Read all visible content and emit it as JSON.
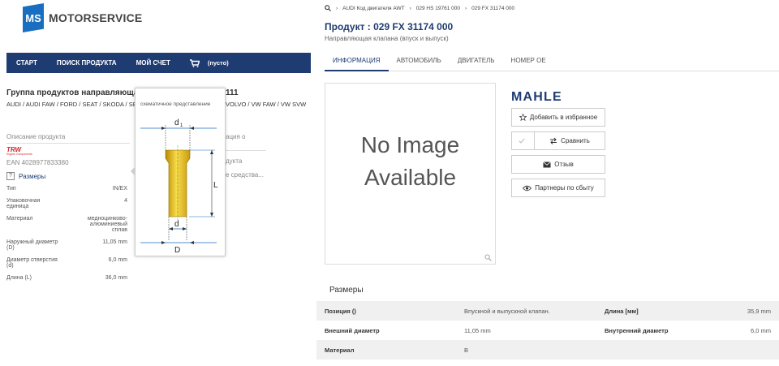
{
  "left": {
    "logo": {
      "mark": "MS",
      "text": "MOTORSERVICE"
    },
    "nav": [
      {
        "label": "СТАРТ"
      },
      {
        "label": "ПОИСК ПРОДУКТА"
      },
      {
        "label": "МОЙ СЧЕТ"
      }
    ],
    "cart": {
      "label": "(пусто)"
    },
    "group_title": "Группа продуктов направляющая",
    "group_title_tail": "111",
    "group_sub": "AUDI / AUDI FAW / FORD / SEAT / SKODA / SE",
    "group_sub_tail": "VOLVO / VW FAW / VW SVW",
    "desc_label": "Описание продукта",
    "info_tail": "ация о",
    "brand": {
      "name": "TRW",
      "tagline": "Engine Components"
    },
    "ean": "EAN 4028977833380",
    "sizes_link": "Размеры",
    "tail_product": "дукта",
    "tail_means": "е средства...",
    "specs": [
      {
        "k": "Тип",
        "v": "IN/EX"
      },
      {
        "k": "Упаковочная единица",
        "v": "4"
      },
      {
        "k": "Материал",
        "v": "медноцинково-алюминиевый сплав"
      },
      {
        "k": "Наружный диаметр (D)",
        "v": "11,05 mm"
      },
      {
        "k": "Диаметр отверстия (d)",
        "v": "6,0 mm"
      },
      {
        "k": "Длина (L)",
        "v": "36,0 mm"
      }
    ],
    "popover": {
      "title": "схематичное представление",
      "labels": {
        "d1": "d",
        "d1_sub": "1",
        "L": "L",
        "d": "d",
        "D": "D"
      }
    }
  },
  "right": {
    "breadcrumb": [
      "AUDI Код двигателя AWT",
      "029 HS 19761 000",
      "029 FX 31174 000"
    ],
    "product_title": "Продукт : 029 FX 31174 000",
    "product_sub": "Направляющая клапана (впуск и выпуск)",
    "tabs": [
      {
        "label": "ИНФОРМАЦИЯ"
      },
      {
        "label": "АВТОМОБИЛЬ"
      },
      {
        "label": "ДВИГАТЕЛЬ"
      },
      {
        "label": "НОМЕР OE"
      }
    ],
    "no_image": [
      "No Image",
      "Available"
    ],
    "brand": "MAHLE",
    "buttons": {
      "favorite": "Добавить в избранное",
      "compare": "Сравнить",
      "review": "Отзыв",
      "partners": "Партнеры по сбыту"
    },
    "sizes_heading": "Размеры",
    "table": [
      {
        "k1": "Позиция ()",
        "v1": "Впускной и выпускной клапан.",
        "k2": "Длина [мм]",
        "v2": "35,9 mm"
      },
      {
        "k1": "Внешний диаметр",
        "v1": "11,05 mm",
        "k2": "Внутренний диаметр",
        "v2": "6,0 mm"
      },
      {
        "k1": "Материал",
        "v1": "B",
        "k2": "",
        "v2": ""
      }
    ]
  },
  "colors": {
    "navy": "#1e3c72",
    "logo_blue": "#1a6ec0",
    "trw_red": "#d4242c",
    "brass": "#e8c020"
  }
}
